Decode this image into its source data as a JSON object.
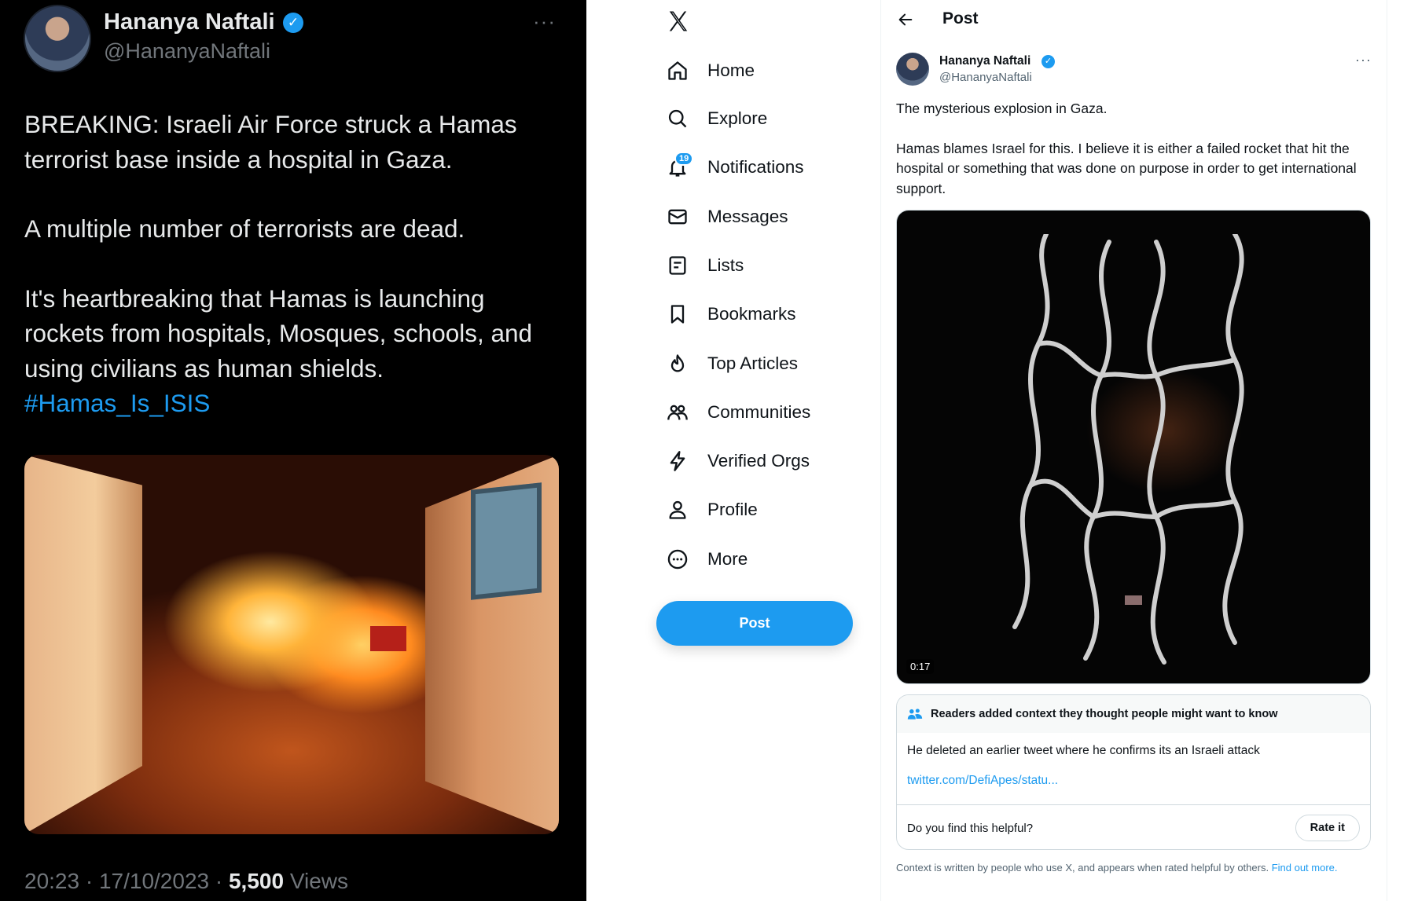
{
  "left_tweet": {
    "name": "Hananya Naftali",
    "handle": "@HananyaNaftali",
    "more_label": "···",
    "paragraphs": [
      "BREAKING: Israeli Air Force struck a Hamas terrorist base inside a hospital in Gaza.",
      "A multiple number of terrorists are dead.",
      "It's heartbreaking that Hamas is launching rockets from hospitals, Mosques, schools, and using civilians as human shields."
    ],
    "hashtag": "#Hamas_Is_ISIS",
    "time": "20:23 · 17/10/2023 · ",
    "views_count": "5,500",
    "views_label": " Views"
  },
  "nav": {
    "items": [
      {
        "label": "Home",
        "icon": "home-icon"
      },
      {
        "label": "Explore",
        "icon": "search-icon"
      },
      {
        "label": "Notifications",
        "icon": "bell-icon",
        "badge": "19"
      },
      {
        "label": "Messages",
        "icon": "envelope-icon"
      },
      {
        "label": "Lists",
        "icon": "list-icon"
      },
      {
        "label": "Bookmarks",
        "icon": "bookmark-icon"
      },
      {
        "label": "Top Articles",
        "icon": "flame-icon"
      },
      {
        "label": "Communities",
        "icon": "people-icon"
      },
      {
        "label": "Verified Orgs",
        "icon": "lightning-icon"
      },
      {
        "label": "Profile",
        "icon": "person-icon"
      },
      {
        "label": "More",
        "icon": "more-circle-icon"
      }
    ],
    "post_button": "Post"
  },
  "post": {
    "header_title": "Post",
    "name": "Hananya Naftali",
    "handle": "@HananyaNaftali",
    "more_label": "···",
    "paragraphs": [
      "The mysterious explosion in Gaza.",
      "Hamas blames Israel for this. I believe it is either a failed rocket that hit the hospital or something that was done on purpose in order to get international support."
    ],
    "video_time": "0:17",
    "note": {
      "header": "Readers added context they thought people might want to know",
      "body": "He deleted an earlier tweet where he confirms its an Israeli attack",
      "link": "twitter.com/DefiApes/statu...",
      "question": "Do you find this helpful?",
      "rate_button": "Rate it"
    },
    "disclaimer": "Context is written by people who use X, and appears when rated helpful by others. ",
    "disclaimer_link": "Find out more."
  },
  "colors": {
    "accent": "#1d9bf0",
    "dark_bg": "#000000",
    "text_primary": "#0f1419",
    "text_secondary": "#536471"
  }
}
